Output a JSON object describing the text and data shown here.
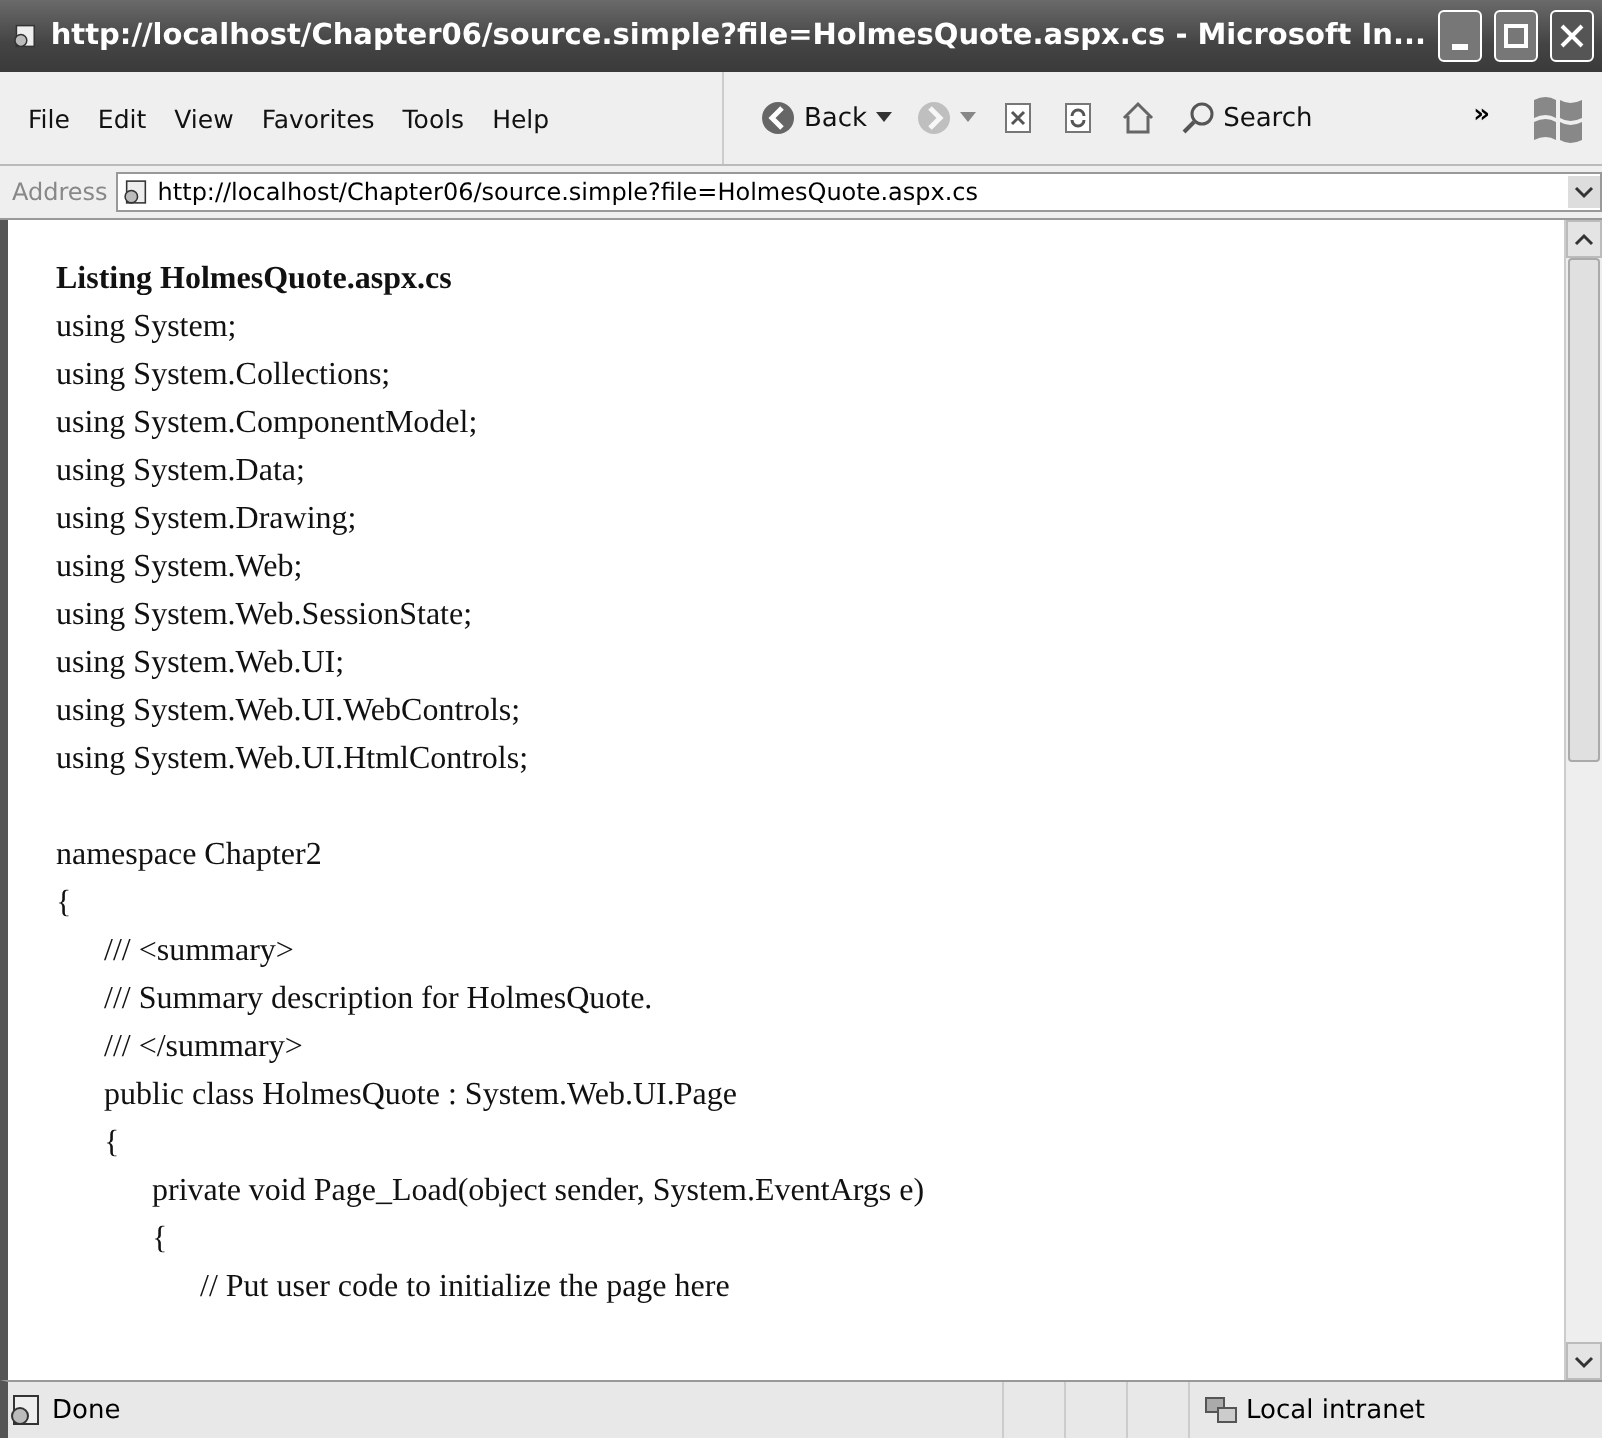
{
  "window": {
    "title": "http://localhost/Chapter06/source.simple?file=HolmesQuote.aspx.cs - Microsoft In..."
  },
  "menu": [
    "File",
    "Edit",
    "View",
    "Favorites",
    "Tools",
    "Help"
  ],
  "toolbar": [
    {
      "kind": "back",
      "label": "Back",
      "disabled": false
    },
    {
      "kind": "forward",
      "disabled": true
    },
    {
      "kind": "stop",
      "disabled": false
    },
    {
      "kind": "refresh",
      "disabled": false
    },
    {
      "kind": "home",
      "disabled": false
    },
    {
      "kind": "search",
      "label": "Search",
      "disabled": false
    }
  ],
  "toolbar_more": "»",
  "address": {
    "label": "Address",
    "url": "http://localhost/Chapter06/source.simple?file=HolmesQuote.aspx.cs"
  },
  "listing": {
    "title": "Listing HolmesQuote.aspx.cs",
    "blocks": [
      [
        "using System;",
        "using System.Collections;",
        "using System.ComponentModel;",
        "using System.Data;",
        "using System.Drawing;",
        "using System.Web;",
        "using System.Web.SessionState;",
        "using System.Web.UI;",
        "using System.Web.UI.WebControls;",
        "using System.Web.UI.HtmlControls;"
      ],
      [
        "namespace Chapter2",
        "{",
        "      /// <summary>",
        "      /// Summary description for HolmesQuote.",
        "      /// </summary>",
        "      public class HolmesQuote : System.Web.UI.Page",
        "      {",
        "            private void Page_Load(object sender, System.EventArgs e)",
        "            {",
        "                  // Put user code to initialize the page here"
      ]
    ]
  },
  "status": {
    "text": "Done",
    "zone": "Local intranet"
  }
}
